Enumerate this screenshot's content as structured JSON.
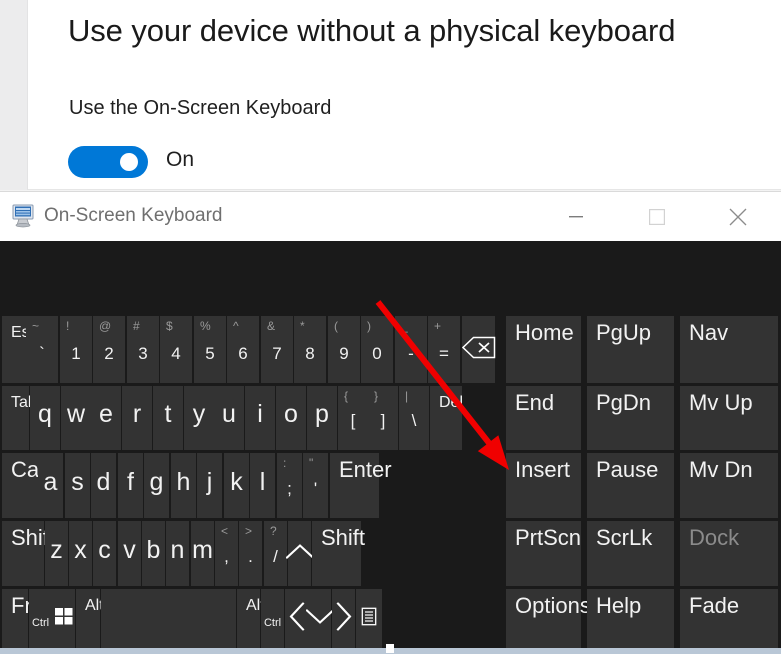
{
  "settings": {
    "page_title": "Use your device without a physical keyboard",
    "section_label": "Use the On-Screen Keyboard",
    "toggle": {
      "state_label": "On",
      "on": true,
      "accent_color": "#0078d7"
    }
  },
  "osk_window": {
    "title": "On-Screen Keyboard",
    "icon": "on-screen-keyboard-icon",
    "controls": {
      "minimize": "minimize-icon",
      "maximize": "maximize-icon",
      "close": "close-icon"
    },
    "background_color": "#1a1a1a",
    "key_color": "#333333"
  },
  "annotation": {
    "type": "red-arrow",
    "color": "#f00000",
    "points_to": "Insert"
  },
  "keyboard": {
    "rows": [
      {
        "name": "number-row",
        "keys": [
          {
            "id": "esc",
            "label": "Esc",
            "style": "small-left"
          },
          {
            "id": "backtick",
            "shifted": "~",
            "base": "`",
            "style": "dual"
          },
          {
            "id": "1",
            "shifted": "!",
            "base": "1",
            "style": "dual"
          },
          {
            "id": "2",
            "shifted": "@",
            "base": "2",
            "style": "dual"
          },
          {
            "id": "3",
            "shifted": "#",
            "base": "3",
            "style": "dual"
          },
          {
            "id": "4",
            "shifted": "$",
            "base": "4",
            "style": "dual"
          },
          {
            "id": "5",
            "shifted": "%",
            "base": "5",
            "style": "dual"
          },
          {
            "id": "6",
            "shifted": "^",
            "base": "6",
            "style": "dual"
          },
          {
            "id": "7",
            "shifted": "&",
            "base": "7",
            "style": "dual"
          },
          {
            "id": "8",
            "shifted": "*",
            "base": "8",
            "style": "dual"
          },
          {
            "id": "9",
            "shifted": "(",
            "base": "9",
            "style": "dual"
          },
          {
            "id": "0",
            "shifted": ")",
            "base": "0",
            "style": "dual"
          },
          {
            "id": "minus",
            "shifted": "_",
            "base": "-",
            "style": "dual"
          },
          {
            "id": "equals",
            "shifted": "+",
            "base": "=",
            "style": "dual"
          },
          {
            "id": "backspace",
            "label": "",
            "style": "icon",
            "icon": "backspace-icon"
          }
        ]
      },
      {
        "name": "qwerty-row",
        "keys": [
          {
            "id": "tab",
            "label": "Tab",
            "style": "small-left"
          },
          {
            "id": "q",
            "label": "q",
            "style": "letter"
          },
          {
            "id": "w",
            "label": "w",
            "style": "letter"
          },
          {
            "id": "e",
            "label": "e",
            "style": "letter"
          },
          {
            "id": "r",
            "label": "r",
            "style": "letter"
          },
          {
            "id": "t",
            "label": "t",
            "style": "letter"
          },
          {
            "id": "y",
            "label": "y",
            "style": "letter"
          },
          {
            "id": "u",
            "label": "u",
            "style": "letter"
          },
          {
            "id": "i",
            "label": "i",
            "style": "letter"
          },
          {
            "id": "o",
            "label": "o",
            "style": "letter"
          },
          {
            "id": "p",
            "label": "p",
            "style": "letter"
          },
          {
            "id": "lbracket",
            "shifted": "{",
            "base": "[",
            "style": "dual"
          },
          {
            "id": "rbracket",
            "shifted": "}",
            "base": "]",
            "style": "dual"
          },
          {
            "id": "backslash",
            "shifted": "|",
            "base": "\\",
            "style": "dual"
          },
          {
            "id": "del",
            "label": "Del",
            "style": "small-left"
          }
        ]
      },
      {
        "name": "home-row",
        "keys": [
          {
            "id": "caps",
            "label": "Caps",
            "style": "big-left"
          },
          {
            "id": "a",
            "label": "a",
            "style": "letter"
          },
          {
            "id": "s",
            "label": "s",
            "style": "letter"
          },
          {
            "id": "d",
            "label": "d",
            "style": "letter"
          },
          {
            "id": "f",
            "label": "f",
            "style": "letter"
          },
          {
            "id": "g",
            "label": "g",
            "style": "letter"
          },
          {
            "id": "h",
            "label": "h",
            "style": "letter"
          },
          {
            "id": "j",
            "label": "j",
            "style": "letter"
          },
          {
            "id": "k",
            "label": "k",
            "style": "letter"
          },
          {
            "id": "l",
            "label": "l",
            "style": "letter"
          },
          {
            "id": "semicolon",
            "shifted": ":",
            "base": ";",
            "style": "dual"
          },
          {
            "id": "quote",
            "shifted": "\"",
            "base": "'",
            "style": "dual"
          },
          {
            "id": "enter",
            "label": "Enter",
            "style": "big-left"
          }
        ]
      },
      {
        "name": "shift-row",
        "keys": [
          {
            "id": "lshift",
            "label": "Shift",
            "style": "big-left"
          },
          {
            "id": "z",
            "label": "z",
            "style": "letter"
          },
          {
            "id": "x",
            "label": "x",
            "style": "letter"
          },
          {
            "id": "c",
            "label": "c",
            "style": "letter"
          },
          {
            "id": "v",
            "label": "v",
            "style": "letter"
          },
          {
            "id": "b",
            "label": "b",
            "style": "letter"
          },
          {
            "id": "n",
            "label": "n",
            "style": "letter"
          },
          {
            "id": "m",
            "label": "m",
            "style": "letter"
          },
          {
            "id": "comma",
            "shifted": "<",
            "base": ",",
            "style": "dual"
          },
          {
            "id": "period",
            "shifted": ">",
            "base": ".",
            "style": "dual"
          },
          {
            "id": "slash",
            "shifted": "?",
            "base": "/",
            "style": "dual"
          },
          {
            "id": "up",
            "label": "",
            "style": "icon",
            "icon": "arrow-up-icon"
          },
          {
            "id": "rshift",
            "label": "Shift",
            "style": "big-left"
          }
        ]
      },
      {
        "name": "bottom-row",
        "keys": [
          {
            "id": "fn",
            "label": "Fn",
            "style": "big-left"
          },
          {
            "id": "lctrl",
            "label": "Ctrl",
            "style": "tiny-center"
          },
          {
            "id": "win",
            "label": "",
            "style": "icon",
            "icon": "windows-icon"
          },
          {
            "id": "lalt",
            "label": "Alt",
            "style": "small-left"
          },
          {
            "id": "space",
            "label": "",
            "style": "blank"
          },
          {
            "id": "ralt",
            "label": "Alt",
            "style": "small-left"
          },
          {
            "id": "rctrl",
            "label": "Ctrl",
            "style": "tiny-center"
          },
          {
            "id": "left",
            "label": "",
            "style": "icon",
            "icon": "arrow-left-icon"
          },
          {
            "id": "down",
            "label": "",
            "style": "icon",
            "icon": "arrow-down-icon"
          },
          {
            "id": "right",
            "label": "",
            "style": "icon",
            "icon": "arrow-right-icon"
          },
          {
            "id": "menu",
            "label": "",
            "style": "icon",
            "icon": "context-menu-icon"
          }
        ]
      }
    ],
    "nav_panel": {
      "name": "navigation-keypad",
      "rows": [
        [
          {
            "id": "home",
            "label": "Home"
          },
          {
            "id": "pgup",
            "label": "PgUp"
          },
          {
            "id": "nav",
            "label": "Nav"
          }
        ],
        [
          {
            "id": "end",
            "label": "End"
          },
          {
            "id": "pgdn",
            "label": "PgDn"
          },
          {
            "id": "mvup",
            "label": "Mv Up"
          }
        ],
        [
          {
            "id": "insert",
            "label": "Insert"
          },
          {
            "id": "pause",
            "label": "Pause"
          },
          {
            "id": "mvdn",
            "label": "Mv Dn"
          }
        ],
        [
          {
            "id": "prtscn",
            "label": "PrtScn"
          },
          {
            "id": "scrlk",
            "label": "ScrLk"
          },
          {
            "id": "dock",
            "label": "Dock",
            "disabled": true
          }
        ],
        [
          {
            "id": "options",
            "label": "Options"
          },
          {
            "id": "help",
            "label": "Help"
          },
          {
            "id": "fade",
            "label": "Fade"
          }
        ]
      ]
    }
  }
}
